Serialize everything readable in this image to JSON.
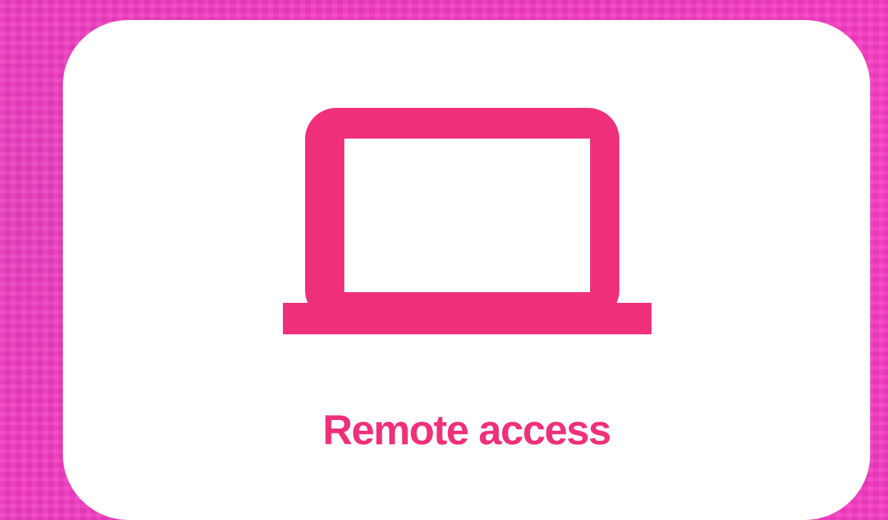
{
  "tile": {
    "label": "Remote access",
    "icon": "laptop-icon",
    "accent_color": "#f0307a",
    "background_color": "#f23bc2"
  }
}
